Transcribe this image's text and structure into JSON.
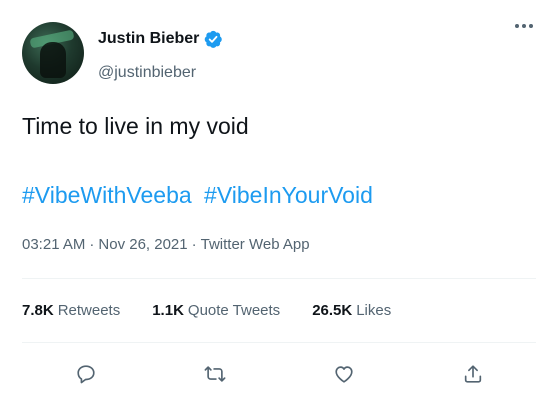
{
  "author": {
    "name": "Justin Bieber",
    "handle": "@justinbieber",
    "verified": true,
    "verified_color": "#1d9bf0"
  },
  "tweet": {
    "text": "Time to live in my void",
    "hashtags": [
      "#VibeWithVeeba",
      "#VibeInYourVoid"
    ],
    "time": "03:21 AM",
    "date": "Nov 26, 2021",
    "source": "Twitter Web App"
  },
  "stats": {
    "retweets_count": "7.8K",
    "retweets_label": "Retweets",
    "quotes_count": "1.1K",
    "quotes_label": "Quote Tweets",
    "likes_count": "26.5K",
    "likes_label": "Likes"
  },
  "actions": [
    "reply-icon",
    "retweet-icon",
    "like-icon",
    "share-icon"
  ],
  "colors": {
    "text": "#0f1419",
    "secondary": "#536471",
    "accent": "#1d9bf0",
    "divider": "#eff3f4"
  }
}
